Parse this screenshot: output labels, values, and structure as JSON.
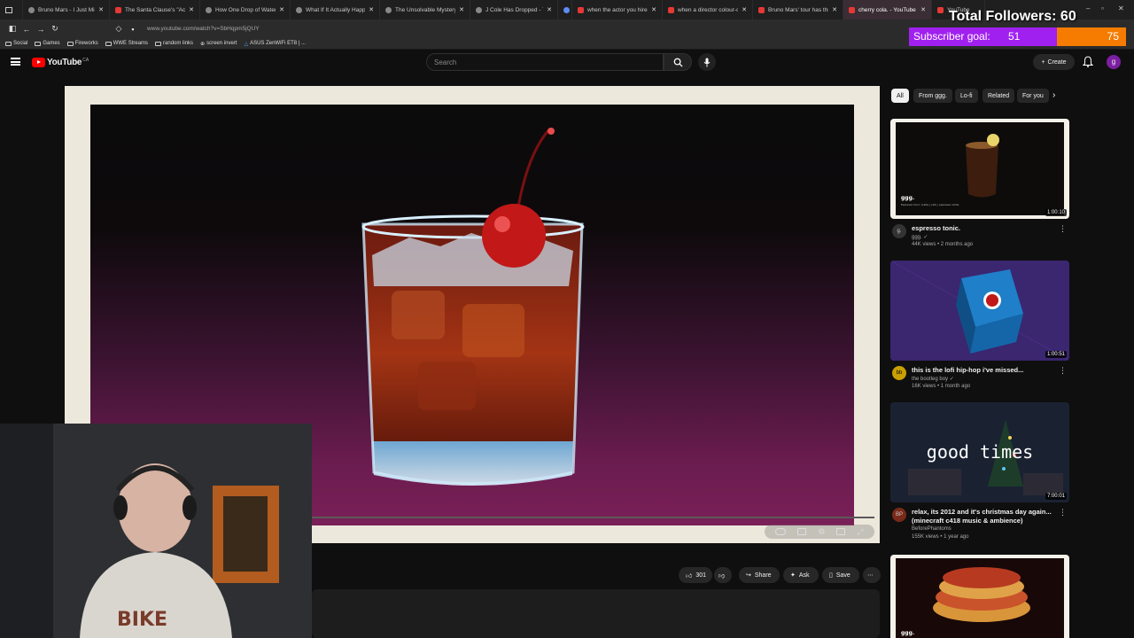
{
  "browser": {
    "tabs": [
      {
        "title": "Bruno Mars - I Just Might [Official",
        "favicon": "generic"
      },
      {
        "title": "The Santa Clause's \"Accidental",
        "favicon": "yt"
      },
      {
        "title": "How One Drop of Water Could",
        "favicon": "generic"
      },
      {
        "title": "What If It Actually Happened",
        "favicon": "generic"
      },
      {
        "title": "The Unsolvable Mystery of",
        "favicon": "generic"
      },
      {
        "title": "J Cole Has Dropped - The Fall",
        "favicon": "generic"
      },
      {
        "title": "",
        "favicon": "blue"
      },
      {
        "title": "when the actor you hired di",
        "favicon": "yt"
      },
      {
        "title": "when a director colour-cod",
        "favicon": "yt"
      },
      {
        "title": "Bruno Mars' tour has three",
        "favicon": "yt"
      },
      {
        "title": "cherry cola. - YouTube",
        "favicon": "yt",
        "active": true
      },
      {
        "title": "YouTube",
        "favicon": "yt"
      }
    ],
    "url": "www.youtube.com/watch?v=SbHqpm5jQUY",
    "bookmarks": [
      "Social",
      "Games",
      "Fireworks",
      "WWE Streams",
      "random links",
      "screen invert",
      "ASUS ZenWiFi ET8 | ..."
    ]
  },
  "overlay": {
    "followers_text": "Total Followers: 60",
    "sub_goal_label": "Subscriber goal:",
    "sub_goal_current": "51",
    "sub_goal_max": "75",
    "sub_goal_progress": 0.68,
    "colors": {
      "fill": "#a020f0",
      "remaining": "#f57c00"
    }
  },
  "youtube": {
    "logo_text": "YouTube",
    "country_code": "CA",
    "search_placeholder": "Search",
    "create_label": "Create",
    "avatar_letter": "g",
    "accent": "#ff0000"
  },
  "video": {
    "likes": "301",
    "share_label": "Share",
    "ask_label": "Ask",
    "save_label": "Save"
  },
  "chips": [
    "All",
    "From ggg.",
    "Lo-fi",
    "Related",
    "For you"
  ],
  "recommended": [
    {
      "title": "espresso tonic.",
      "channel": "ggg.",
      "meta": "44K views • 2 months ago",
      "duration": "1:00:10",
      "thumb_label": "ggg.",
      "thumb_sublabel": "Espresso tonic (cafe) | (all) | espresso shots",
      "avatar": "g.",
      "verified": true
    },
    {
      "title": "this is the lofi hip-hop i've missed...",
      "channel": "the bootleg boy",
      "meta": "16K views • 1 month ago",
      "duration": "1:00:51",
      "avatar": "bb",
      "verified": true
    },
    {
      "title": "relax, its 2012 and it's christmas day again... (minecraft c418 music & ambience)",
      "channel": "BeforePhantoms",
      "meta": "155K views • 1 year ago",
      "duration": "7:00:01",
      "thumb_text": "good times",
      "avatar": "BP",
      "verified": false
    },
    {
      "title": "",
      "channel": "",
      "meta": "",
      "duration": "",
      "thumb_label": "ggg.",
      "avatar": "",
      "verified": false
    }
  ]
}
